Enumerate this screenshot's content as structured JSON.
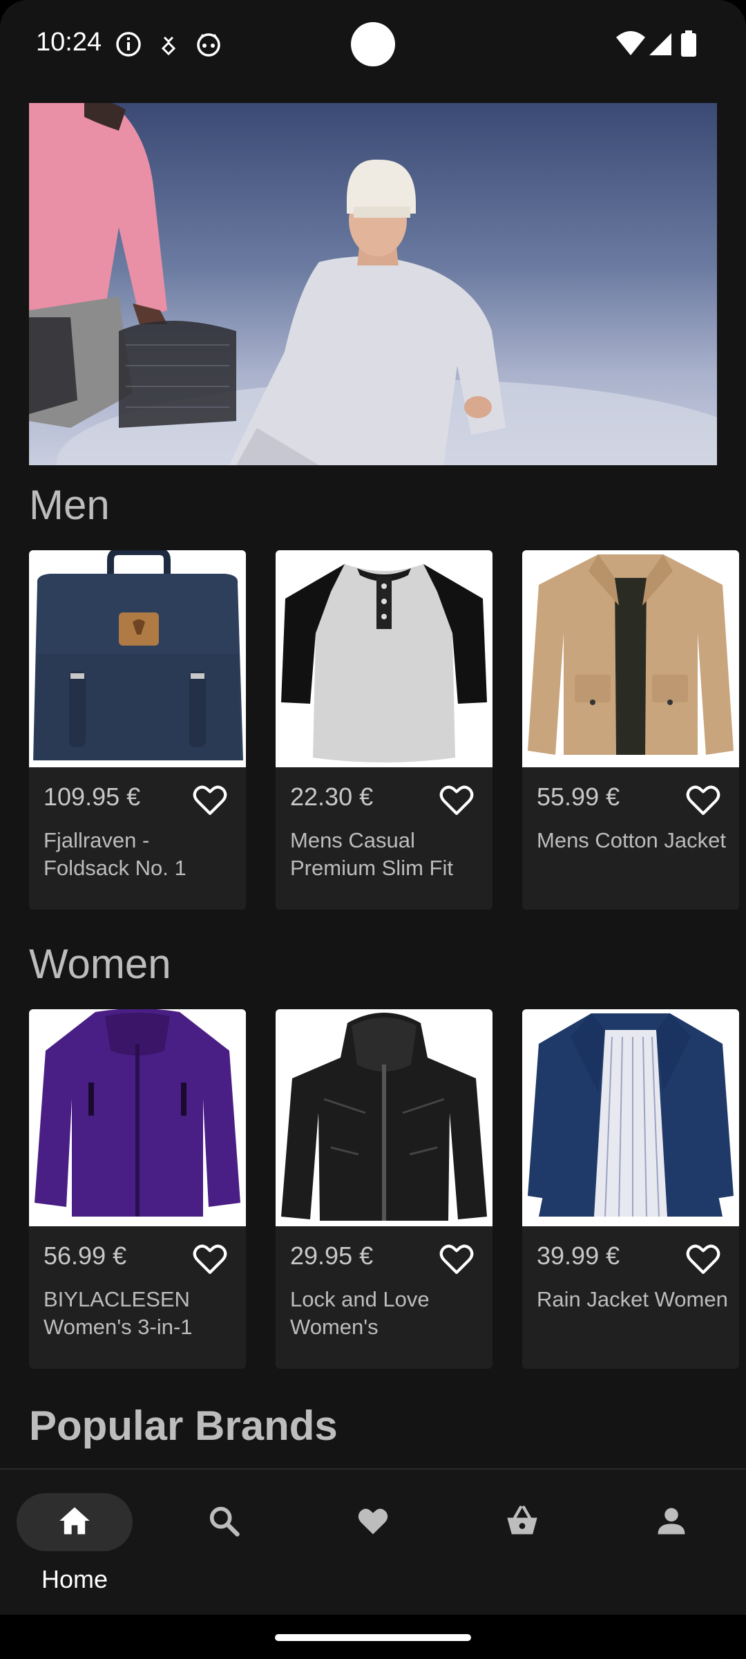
{
  "status_bar": {
    "time": "10:24",
    "left_icons": [
      "info-icon",
      "download-notification-icon",
      "app-notification-icon"
    ],
    "right_icons": [
      "wifi-icon",
      "signal-icon",
      "battery-icon"
    ]
  },
  "hero": {
    "image": "banner-image"
  },
  "sections": {
    "men": {
      "title": "Men",
      "products": [
        {
          "price": "109.95 €",
          "title": "Fjallraven - Foldsack No. 1",
          "image": "backpack-image"
        },
        {
          "price": "22.30 €",
          "title": "Mens Casual Premium Slim Fit",
          "image": "raglan-tshirt-image"
        },
        {
          "price": "55.99 €",
          "title": "Mens Cotton Jacket",
          "image": "beige-jacket-image"
        }
      ]
    },
    "women": {
      "title": "Women",
      "products": [
        {
          "price": "56.99 €",
          "title": "BIYLACLESEN Women's 3-in-1",
          "image": "purple-jacket-image"
        },
        {
          "price": "29.95 €",
          "title": "Lock and Love Women's",
          "image": "leather-jacket-image"
        },
        {
          "price": "39.99 €",
          "title": "Rain Jacket Women",
          "image": "navy-rain-jacket-image"
        }
      ]
    },
    "brands": {
      "title": "Popular Brands"
    }
  },
  "nav": {
    "items": [
      {
        "label": "Home",
        "icon": "home-icon",
        "selected": true
      },
      {
        "label": "",
        "icon": "search-icon"
      },
      {
        "label": "",
        "icon": "heart-filled-icon"
      },
      {
        "label": "",
        "icon": "basket-icon"
      },
      {
        "label": "",
        "icon": "profile-icon"
      }
    ]
  },
  "colors": {
    "background": "#141414",
    "card": "#202020",
    "text_muted": "#bdbdbd",
    "nav_pill": "#2e2e2e"
  }
}
